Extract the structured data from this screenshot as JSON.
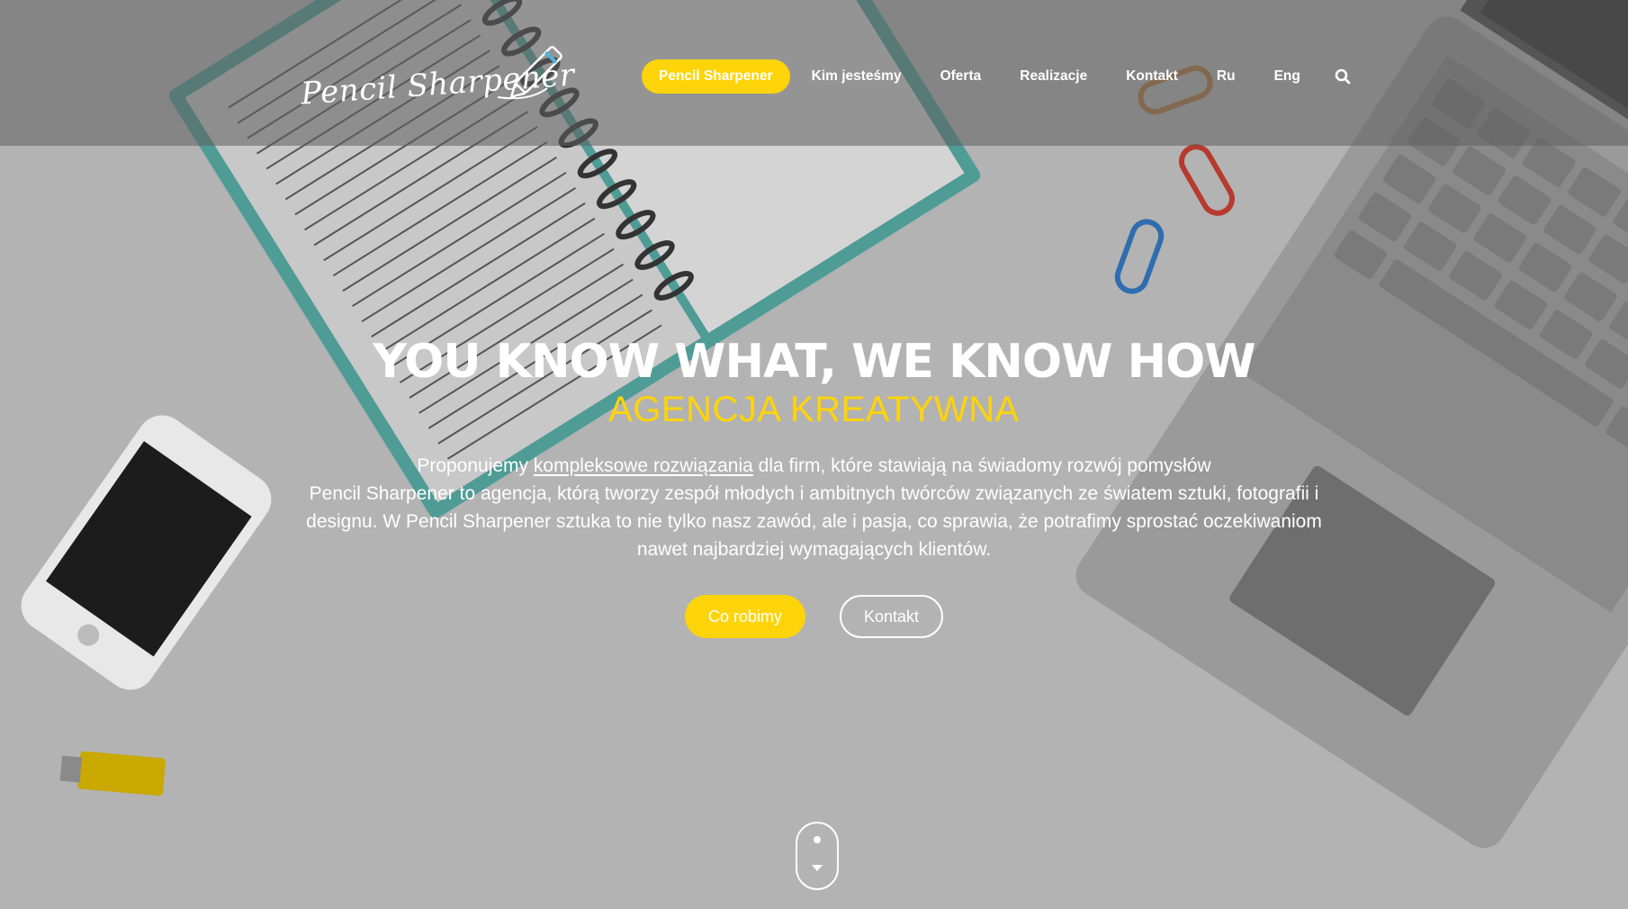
{
  "brand": {
    "logo_text": "Pencil Sharpener"
  },
  "nav": {
    "items": [
      {
        "label": "Pencil Sharpener",
        "active": true
      },
      {
        "label": "Kim jesteśmy",
        "active": false
      },
      {
        "label": "Oferta",
        "active": false
      },
      {
        "label": "Realizacje",
        "active": false
      },
      {
        "label": "Kontakt",
        "active": false
      },
      {
        "label": "Ru",
        "active": false
      },
      {
        "label": "Eng",
        "active": false
      }
    ],
    "search_icon": "search-icon"
  },
  "hero": {
    "title": "YOU KNOW WHAT, WE KNOW HOW",
    "subtitle": "AGENCJA KREATYWNA",
    "lead_before": "Proponujemy ",
    "lead_link": "kompleksowe rozwiązania",
    "lead_after": " dla firm, które stawiają na świadomy rozwój pomysłów",
    "description": "Pencil Sharpener to agencja, którą tworzy zespół młodych i ambitnych twórców związanych ze światem sztuki, fotografii i designu. W Pencil Sharpener sztuka to nie tylko nasz zawód, ale i pasja, co sprawia, że potrafimy sprostać oczekiwaniom nawet najbardziej wymagających klientów.",
    "primary_button": "Co robimy",
    "secondary_button": "Kontakt"
  },
  "colors": {
    "accent": "#fdd409",
    "header_overlay": "#5f5f5f",
    "background": "#b3b3b3",
    "text": "#ffffff"
  },
  "icons": {
    "scroll": "mouse-scroll-icon",
    "pencil": "pencil-icon"
  }
}
